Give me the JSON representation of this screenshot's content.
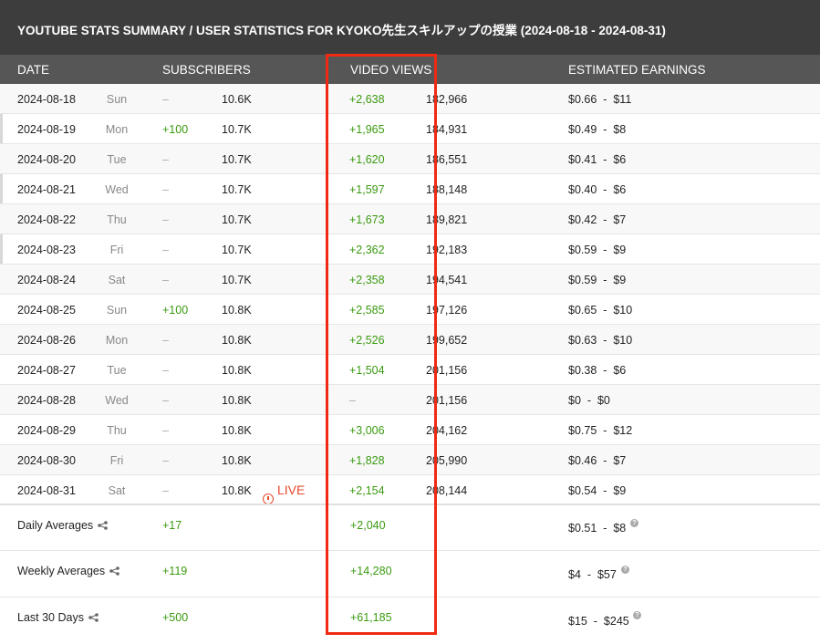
{
  "title": "YOUTUBE STATS SUMMARY / USER STATISTICS FOR KYOKO先生スキルアップの授業 (2024-08-18 - 2024-08-31)",
  "columns": {
    "date": "DATE",
    "subscribers": "SUBSCRIBERS",
    "video_views": "VIDEO VIEWS",
    "earnings": "ESTIMATED EARNINGS"
  },
  "rows": [
    {
      "date": "2024-08-18",
      "day": "Sun",
      "sub_change": "–",
      "sub_total": "10.6K",
      "view_change": "+2,638",
      "view_total": "182,966",
      "earn_low": "$0.66",
      "earn_high": "$11"
    },
    {
      "date": "2024-08-19",
      "day": "Mon",
      "sub_change": "+100",
      "sub_total": "10.7K",
      "view_change": "+1,965",
      "view_total": "184,931",
      "earn_low": "$0.49",
      "earn_high": "$8"
    },
    {
      "date": "2024-08-20",
      "day": "Tue",
      "sub_change": "–",
      "sub_total": "10.7K",
      "view_change": "+1,620",
      "view_total": "186,551",
      "earn_low": "$0.41",
      "earn_high": "$6"
    },
    {
      "date": "2024-08-21",
      "day": "Wed",
      "sub_change": "–",
      "sub_total": "10.7K",
      "view_change": "+1,597",
      "view_total": "188,148",
      "earn_low": "$0.40",
      "earn_high": "$6"
    },
    {
      "date": "2024-08-22",
      "day": "Thu",
      "sub_change": "–",
      "sub_total": "10.7K",
      "view_change": "+1,673",
      "view_total": "189,821",
      "earn_low": "$0.42",
      "earn_high": "$7"
    },
    {
      "date": "2024-08-23",
      "day": "Fri",
      "sub_change": "–",
      "sub_total": "10.7K",
      "view_change": "+2,362",
      "view_total": "192,183",
      "earn_low": "$0.59",
      "earn_high": "$9"
    },
    {
      "date": "2024-08-24",
      "day": "Sat",
      "sub_change": "–",
      "sub_total": "10.7K",
      "view_change": "+2,358",
      "view_total": "194,541",
      "earn_low": "$0.59",
      "earn_high": "$9"
    },
    {
      "date": "2024-08-25",
      "day": "Sun",
      "sub_change": "+100",
      "sub_total": "10.8K",
      "view_change": "+2,585",
      "view_total": "197,126",
      "earn_low": "$0.65",
      "earn_high": "$10"
    },
    {
      "date": "2024-08-26",
      "day": "Mon",
      "sub_change": "–",
      "sub_total": "10.8K",
      "view_change": "+2,526",
      "view_total": "199,652",
      "earn_low": "$0.63",
      "earn_high": "$10"
    },
    {
      "date": "2024-08-27",
      "day": "Tue",
      "sub_change": "–",
      "sub_total": "10.8K",
      "view_change": "+1,504",
      "view_total": "201,156",
      "earn_low": "$0.38",
      "earn_high": "$6"
    },
    {
      "date": "2024-08-28",
      "day": "Wed",
      "sub_change": "–",
      "sub_total": "10.8K",
      "view_change": "–",
      "view_total": "201,156",
      "earn_low": "$0",
      "earn_high": "$0"
    },
    {
      "date": "2024-08-29",
      "day": "Thu",
      "sub_change": "–",
      "sub_total": "10.8K",
      "view_change": "+3,006",
      "view_total": "204,162",
      "earn_low": "$0.75",
      "earn_high": "$12"
    },
    {
      "date": "2024-08-30",
      "day": "Fri",
      "sub_change": "–",
      "sub_total": "10.8K",
      "view_change": "+1,828",
      "view_total": "205,990",
      "earn_low": "$0.46",
      "earn_high": "$7"
    },
    {
      "date": "2024-08-31",
      "day": "Sat",
      "sub_change": "–",
      "sub_total": "10.8K",
      "view_change": "+2,154",
      "view_total": "208,144",
      "earn_low": "$0.54",
      "earn_high": "$9",
      "live": "LIVE"
    }
  ],
  "summary": [
    {
      "label": "Daily Averages",
      "sub": "+17",
      "views": "+2,040",
      "earn_low": "$0.51",
      "earn_high": "$8"
    },
    {
      "label": "Weekly Averages",
      "sub": "+119",
      "views": "+14,280",
      "earn_low": "$4",
      "earn_high": "$57"
    },
    {
      "label": "Last 30 Days",
      "sub": "+500",
      "views": "+61,185",
      "earn_low": "$15",
      "earn_high": "$245"
    }
  ],
  "icons": {
    "share": "share-icon",
    "help": "help-icon",
    "live": "live-icon"
  },
  "colors": {
    "header_bg": "#3d3d3d",
    "column_header_bg": "#565656",
    "positive": "#3a9a10",
    "live": "#e64a2e",
    "highlight": "#f02a12"
  }
}
